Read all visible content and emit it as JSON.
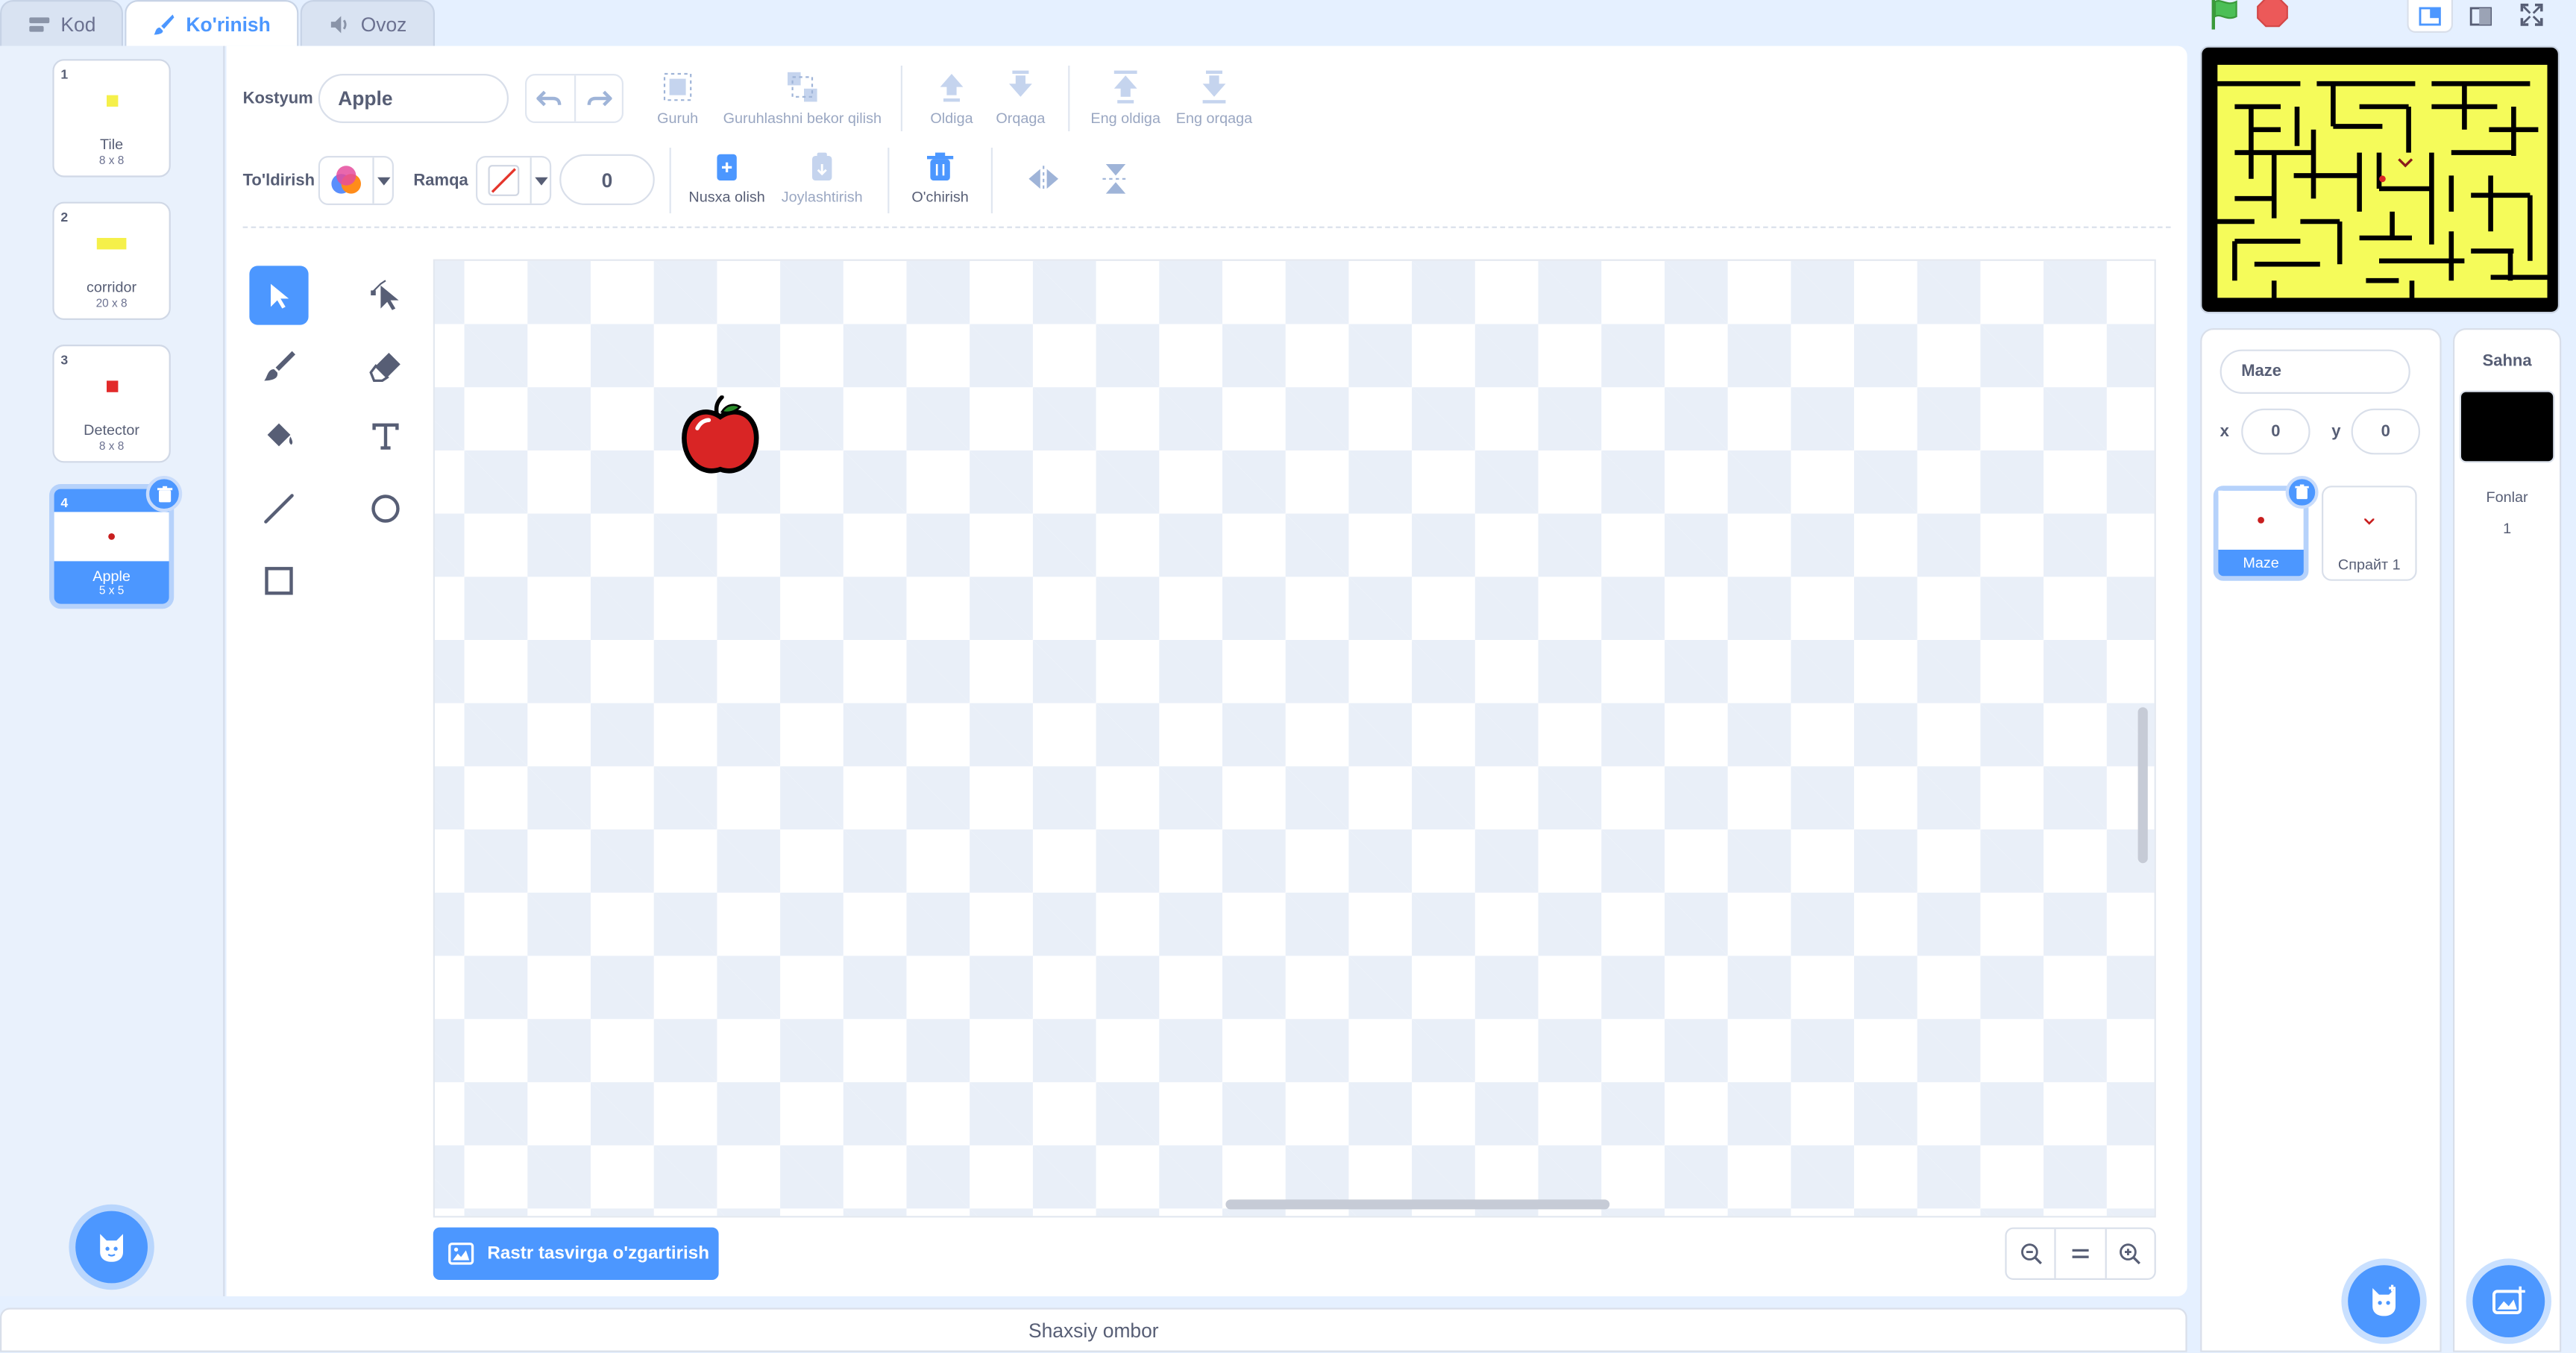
{
  "tabs": [
    {
      "label": "Kod"
    },
    {
      "label": "Ko'rinish"
    },
    {
      "label": "Ovoz"
    }
  ],
  "costumes": [
    {
      "num": "1",
      "name": "Tile",
      "size": "8 x 8",
      "color": "#f5f04a"
    },
    {
      "num": "2",
      "name": "corridor",
      "size": "20 x 8",
      "color": "#f5f04a"
    },
    {
      "num": "3",
      "name": "Detector",
      "size": "8 x 8",
      "color": "#e22a2a"
    },
    {
      "num": "4",
      "name": "Apple",
      "size": "5 x 5",
      "color": "#c81e1e"
    }
  ],
  "editor": {
    "costume_label": "Kostyum",
    "costume_name": "Apple",
    "group": "Guruh",
    "ungroup": "Guruhlashni bekor qilish",
    "forward": "Oldiga",
    "backward": "Orqaga",
    "front": "Eng oldiga",
    "back": "Eng orqaga",
    "fill_label": "To'ldirish",
    "outline_label": "Ramqa",
    "outline_width": "0",
    "copy": "Nusxa olish",
    "paste": "Joylashtirish",
    "delete": "O'chirish",
    "convert_btn": "Rastr tasvirga o'zgartirish"
  },
  "backpack": "Shaxsiy ombor",
  "sprite_info": {
    "name": "Maze",
    "x_label": "x",
    "x_value": "0",
    "y_label": "y",
    "y_value": "0"
  },
  "sprites": [
    {
      "name": "Maze"
    },
    {
      "name": "Спрайт 1"
    }
  ],
  "stage_pane": {
    "title": "Sahna",
    "backdrops_label": "Fonlar",
    "backdrops_count": "1"
  },
  "colors": {
    "accent": "#4c97ff",
    "maze_yellow": "#f5fb5a",
    "apple_red": "#d92525"
  }
}
